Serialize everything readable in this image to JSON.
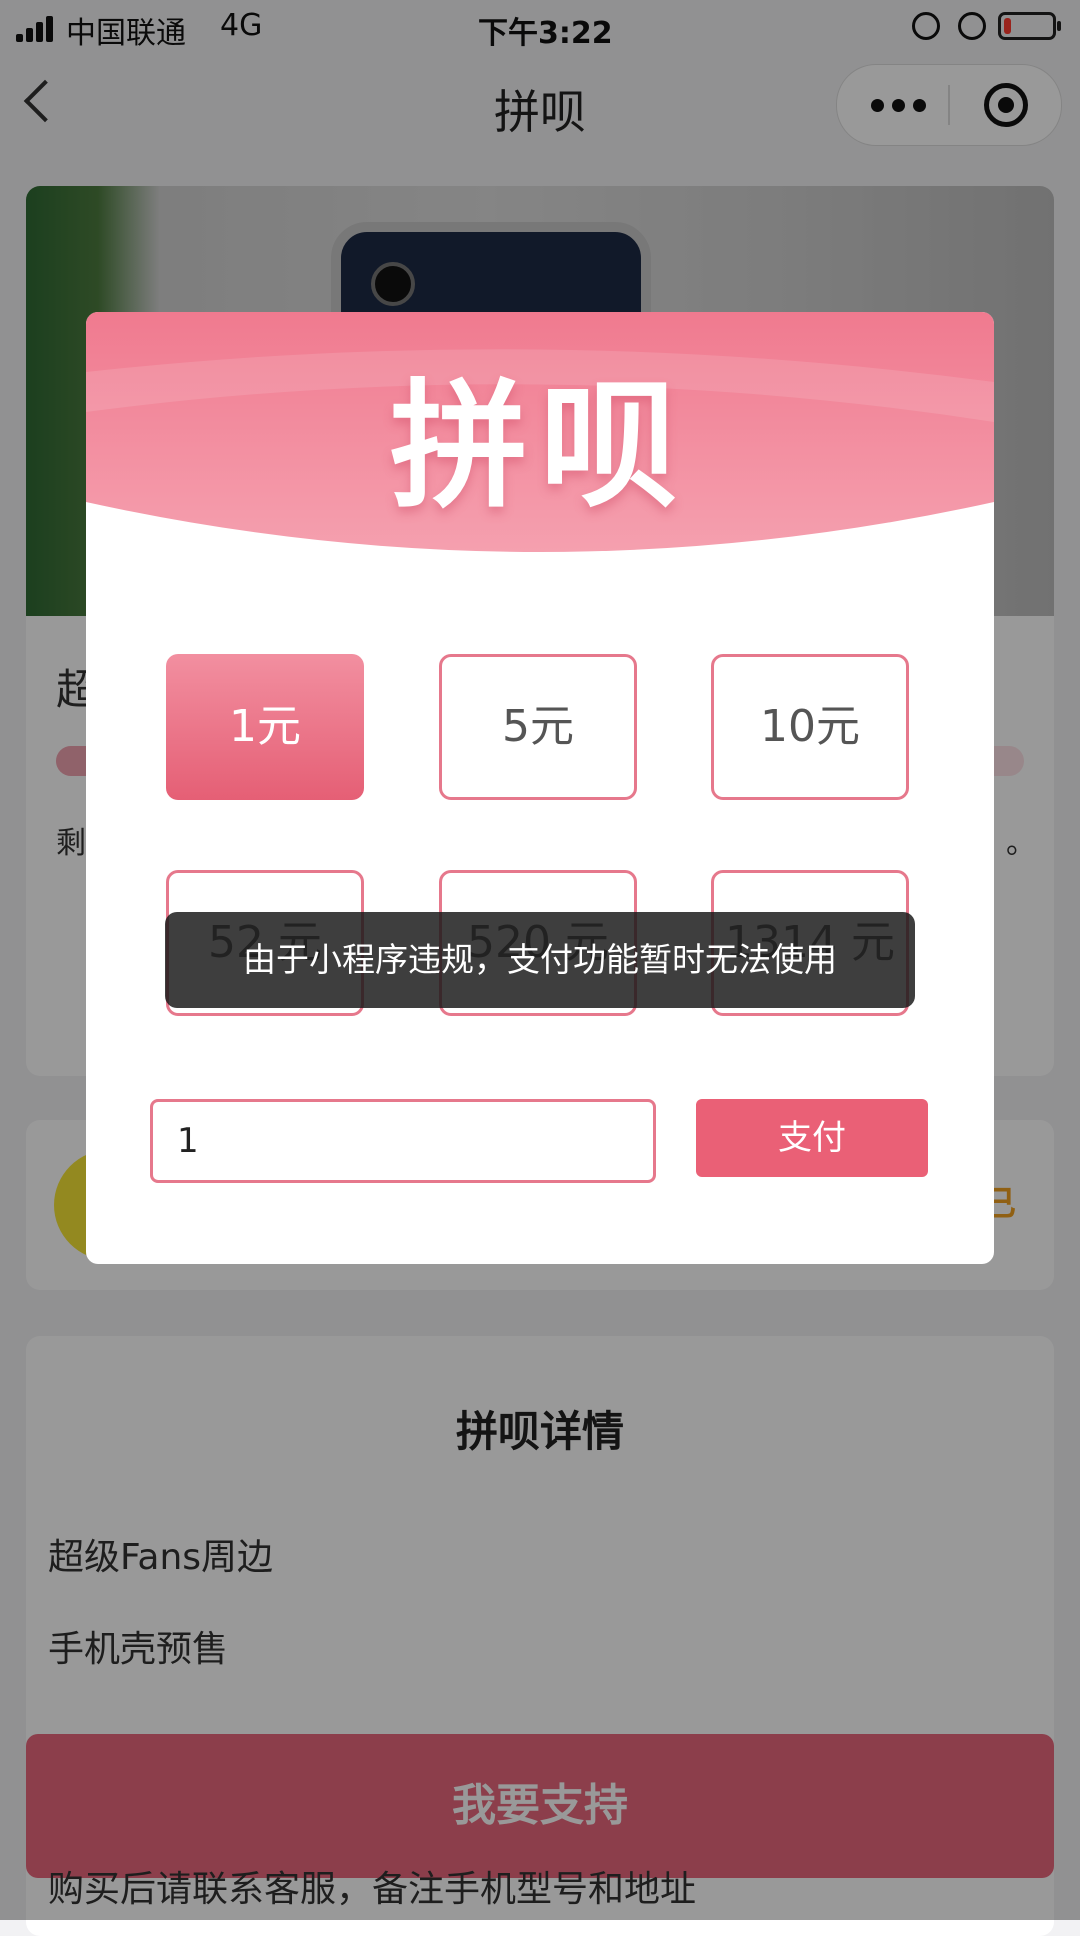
{
  "status_bar": {
    "carrier": "中国联通",
    "network": "4G",
    "time": "下午3:22",
    "battery_level": 0.15,
    "icons": [
      "signal-icon",
      "orientation-lock-icon",
      "alarm-icon",
      "battery-icon"
    ]
  },
  "nav": {
    "title": "拼呗",
    "icons": [
      "back-arrow-icon",
      "more-dots-icon",
      "target-icon"
    ]
  },
  "background": {
    "hero_title": "超",
    "progress": 0.12,
    "remain_label": "剩",
    "remain_end": "。",
    "sponsor_badge": "已",
    "details_title": "拼呗详情",
    "detail_lines": [
      "超级Fans周边",
      "手机壳预售"
    ],
    "support_button": "我要支持",
    "bottom_note": "购买后请联系客服，备注手机型号和地址"
  },
  "modal": {
    "banner_text": "拼呗",
    "amount_options": [
      {
        "label": "1元",
        "selected": true
      },
      {
        "label": "5元",
        "selected": false
      },
      {
        "label": "10元",
        "selected": false
      },
      {
        "label": "52 元",
        "selected": false
      },
      {
        "label": "520 元",
        "selected": false
      },
      {
        "label": "1314 元",
        "selected": false
      }
    ],
    "amount_input_value": "1",
    "pay_button": "支付"
  },
  "toast": {
    "message": "由于小程序违规，支付功能暂时无法使用"
  },
  "colors": {
    "accent_pink": "#ea6076",
    "option_border": "#e6788c",
    "sponsor_yellow": "#f5e536"
  }
}
